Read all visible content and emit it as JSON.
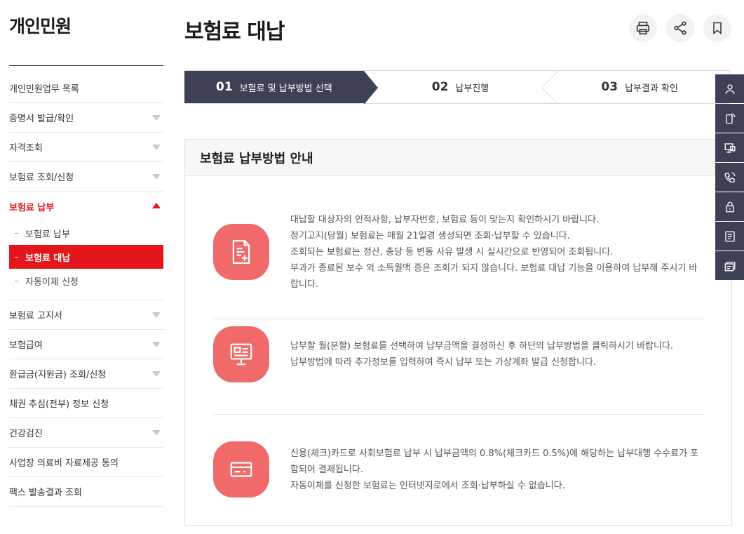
{
  "sidebar": {
    "title": "개인민원",
    "items": [
      {
        "label": "개인민원업무 목록",
        "arrow": false
      },
      {
        "label": "증명서 발급/확인",
        "arrow": true
      },
      {
        "label": "자격조회",
        "arrow": true
      },
      {
        "label": "보험료 조회/신청",
        "arrow": true
      },
      {
        "label": "보험료 납부",
        "arrow": true,
        "active": true
      }
    ],
    "subitems": [
      {
        "label": "보험료 납부"
      },
      {
        "label": "보험료 대납",
        "current": true
      },
      {
        "label": "자동이체 신청"
      }
    ],
    "items_after": [
      {
        "label": "보험료 고지서",
        "arrow": true
      },
      {
        "label": "보험급여",
        "arrow": true
      },
      {
        "label": "환급금(지원금) 조회/신청",
        "arrow": true
      },
      {
        "label": "채권 추심(전부) 정보 신청",
        "arrow": false
      },
      {
        "label": "건강검진",
        "arrow": true
      },
      {
        "label": "사업장 의료비 자료제공 동의",
        "arrow": false
      },
      {
        "label": "팩스 발송결과 조회",
        "arrow": false
      }
    ]
  },
  "page": {
    "title": "보험료 대납"
  },
  "header_icons": [
    "printer-icon",
    "share-icon",
    "bookmark-icon"
  ],
  "steps": [
    {
      "num": "01",
      "label": "보험료 및 납부방법 선택",
      "current": true
    },
    {
      "num": "02",
      "label": "납부진행"
    },
    {
      "num": "03",
      "label": "납부결과 확인"
    }
  ],
  "panel": {
    "title": "보험료 납부방법 안내",
    "rows": [
      {
        "icon": "document-add-icon",
        "lines": [
          "대납할 대상자의 인적사항, 납부자번호, 보험료 등이 맞는지 확인하시기 바랍니다.",
          "정기고지(당월) 보험료는 매월 21일경 생성되면 조회·납부할 수 있습니다.",
          "조회되는 보험료는 정산, 충당 등 변동 사유 발생 시 실시간으로 반영되어 조회됩니다.",
          "부과가 종료된 보수 외 소득월액 증은 조회가 되지 않습니다. 보험료 대납 기능을 이용하여 납부해 주시기 바랍니다."
        ]
      },
      {
        "icon": "monitor-icon",
        "lines": [
          "납부할 월(분할) 보험료를 선택하여 납부금액을 결정하신 후 하단의 납부방법을 클릭하시기 바랍니다.",
          "납부방법에 따라 추가정보를 입력하여 즉시 납부 또는 가상계좌 발급 신청합니다."
        ]
      },
      {
        "icon": "card-icon",
        "lines": [
          "신용(체크)카드로 사회보험료 납부 시 납부금액의 0.8%(체크카드 0.5%)에 해당하는 납부대행 수수료가 포함되어 결제됩니다.",
          "자동이체를 신청한 보험료는 인터넷지로에서 조회·납부하실 수 없습니다."
        ]
      }
    ]
  },
  "quickbar": [
    "person-icon",
    "phone-chat-icon",
    "remote-support-icon",
    "call-icon",
    "lock-icon",
    "notice-icon",
    "cards-icon"
  ],
  "colors": {
    "accent": "#e4151b",
    "dark": "#3e4055",
    "icon_bg": "#f06a6a"
  }
}
